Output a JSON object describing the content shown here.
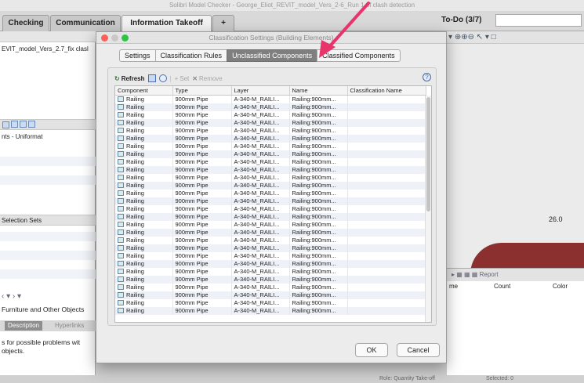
{
  "app": {
    "title": "Solibri Model Checker - George_Eliot_REVIT_model_Vers_2-6_Run 1 of clash detection",
    "tabs": [
      "Checking",
      "Communication",
      "Information Takeoff",
      "+"
    ],
    "todo_label": "To-Do (3/7)"
  },
  "left_pane": {
    "model_name": "EVIT_model_Vers_2.7_fix clasl",
    "classification": "nts - Uniformat",
    "selection_sets": "Selection Sets",
    "category": "Furniture and Other Objects",
    "tabs": [
      "Description",
      "Hyperlinks"
    ],
    "description": "s for possible problems wit",
    "description2": "objects."
  },
  "viewport": {
    "dimension": "26.0"
  },
  "report_pane": {
    "toolbar_label": "Report",
    "columns": [
      "me",
      "Count",
      "Color"
    ]
  },
  "statusbar": {
    "role": "Role: Quantity Take-off",
    "selected": "Selected: 0"
  },
  "dialog": {
    "title": "Classification Settings (Building Elements)",
    "tabs": [
      {
        "label": "Settings",
        "active": false
      },
      {
        "label": "Classification Rules",
        "active": false
      },
      {
        "label": "Unclassified Components",
        "active": true
      },
      {
        "label": "Classified Components",
        "active": false
      }
    ],
    "toolbar": {
      "refresh": "Refresh",
      "set": "Set",
      "remove": "Remove"
    },
    "columns": [
      "Component",
      "Type",
      "Layer",
      "Name",
      "Classification Name"
    ],
    "rows": [
      {
        "component": "Railing",
        "type": "900mm Pipe",
        "layer": "A-340-M_RAILI...",
        "name": "Railing:900mm...",
        "classification": ""
      },
      {
        "component": "Railing",
        "type": "900mm Pipe",
        "layer": "A-340-M_RAILI...",
        "name": "Railing:900mm...",
        "classification": ""
      },
      {
        "component": "Railing",
        "type": "900mm Pipe",
        "layer": "A-340-M_RAILI...",
        "name": "Railing:900mm...",
        "classification": ""
      },
      {
        "component": "Railing",
        "type": "900mm Pipe",
        "layer": "A-340-M_RAILI...",
        "name": "Railing:900mm...",
        "classification": ""
      },
      {
        "component": "Railing",
        "type": "900mm Pipe",
        "layer": "A-340-M_RAILI...",
        "name": "Railing:900mm...",
        "classification": ""
      },
      {
        "component": "Railing",
        "type": "900mm Pipe",
        "layer": "A-340-M_RAILI...",
        "name": "Railing:900mm...",
        "classification": ""
      },
      {
        "component": "Railing",
        "type": "900mm Pipe",
        "layer": "A-340-M_RAILI...",
        "name": "Railing:900mm...",
        "classification": ""
      },
      {
        "component": "Railing",
        "type": "900mm Pipe",
        "layer": "A-340-M_RAILI...",
        "name": "Railing:900mm...",
        "classification": ""
      },
      {
        "component": "Railing",
        "type": "900mm Pipe",
        "layer": "A-340-M_RAILI...",
        "name": "Railing:900mm...",
        "classification": ""
      },
      {
        "component": "Railing",
        "type": "900mm Pipe",
        "layer": "A-340-M_RAILI...",
        "name": "Railing:900mm...",
        "classification": ""
      },
      {
        "component": "Railing",
        "type": "900mm Pipe",
        "layer": "A-340-M_RAILI...",
        "name": "Railing:900mm...",
        "classification": ""
      },
      {
        "component": "Railing",
        "type": "900mm Pipe",
        "layer": "A-340-M_RAILI...",
        "name": "Railing:900mm...",
        "classification": ""
      },
      {
        "component": "Railing",
        "type": "900mm Pipe",
        "layer": "A-340-M_RAILI...",
        "name": "Railing:900mm...",
        "classification": ""
      },
      {
        "component": "Railing",
        "type": "900mm Pipe",
        "layer": "A-340-M_RAILI...",
        "name": "Railing:900mm...",
        "classification": ""
      },
      {
        "component": "Railing",
        "type": "900mm Pipe",
        "layer": "A-340-M_RAILI...",
        "name": "Railing:900mm...",
        "classification": ""
      },
      {
        "component": "Railing",
        "type": "900mm Pipe",
        "layer": "A-340-M_RAILI...",
        "name": "Railing:900mm...",
        "classification": ""
      },
      {
        "component": "Railing",
        "type": "900mm Pipe",
        "layer": "A-340-M_RAILI...",
        "name": "Railing:900mm...",
        "classification": ""
      },
      {
        "component": "Railing",
        "type": "900mm Pipe",
        "layer": "A-340-M_RAILI...",
        "name": "Railing:900mm...",
        "classification": ""
      },
      {
        "component": "Railing",
        "type": "900mm Pipe",
        "layer": "A-340-M_RAILI...",
        "name": "Railing:900mm...",
        "classification": ""
      },
      {
        "component": "Railing",
        "type": "900mm Pipe",
        "layer": "A-340-M_RAILI...",
        "name": "Railing:900mm...",
        "classification": ""
      },
      {
        "component": "Railing",
        "type": "900mm Pipe",
        "layer": "A-340-M_RAILI...",
        "name": "Railing:900mm...",
        "classification": ""
      },
      {
        "component": "Railing",
        "type": "900mm Pipe",
        "layer": "A-340-M_RAILI...",
        "name": "Railing:900mm...",
        "classification": ""
      },
      {
        "component": "Railing",
        "type": "900mm Pipe",
        "layer": "A-340-M_RAILI...",
        "name": "Railing:900mm...",
        "classification": ""
      },
      {
        "component": "Railing",
        "type": "900mm Pipe",
        "layer": "A-340-M_RAILI...",
        "name": "Railing:900mm...",
        "classification": ""
      },
      {
        "component": "Railing",
        "type": "900mm Pipe",
        "layer": "A-340-M_RAILI...",
        "name": "Railing:900mm...",
        "classification": ""
      },
      {
        "component": "Railing",
        "type": "900mm Pipe",
        "layer": "A-340-M_RAILI...",
        "name": "Railing:900mm...",
        "classification": ""
      },
      {
        "component": "Railing",
        "type": "900mm Pipe",
        "layer": "A-340-M_RAILI...",
        "name": "Railing:900mm...",
        "classification": ""
      },
      {
        "component": "Railing",
        "type": "900mm Pipe",
        "layer": "A-340-M_RAILI...",
        "name": "Railing:900mm...",
        "classification": ""
      }
    ],
    "ok_label": "OK",
    "cancel_label": "Cancel"
  },
  "colors": {
    "active_tab": "#7f7f7f",
    "row_stripe": "#eef2f8",
    "model_red": "#8b2f2f",
    "annotation_arrow": "#e8336b"
  }
}
